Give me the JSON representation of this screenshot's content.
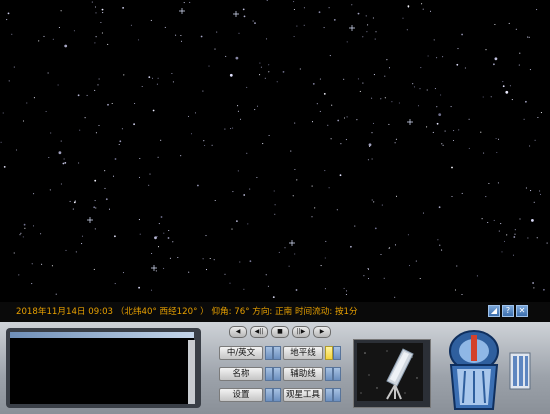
{
  "status": {
    "text": "2018年11月14日 09:03 （北纬40° 西经120° ） 仰角: 76° 方向: 正南 时间流动: 按1分"
  },
  "window_buttons": [
    "◢",
    "?",
    "✕"
  ],
  "media_buttons": [
    "◀",
    "◀||",
    "■",
    "||▶",
    "▶"
  ],
  "controls": {
    "lang": "中/英文",
    "name": "名称",
    "settings": "设置",
    "horizon": "地平线",
    "aux": "辅助线",
    "tools": "观星工具"
  },
  "colors": {
    "status_text": "#e8a000",
    "sky": "#000000",
    "indicator_active": "#f4d33c"
  }
}
